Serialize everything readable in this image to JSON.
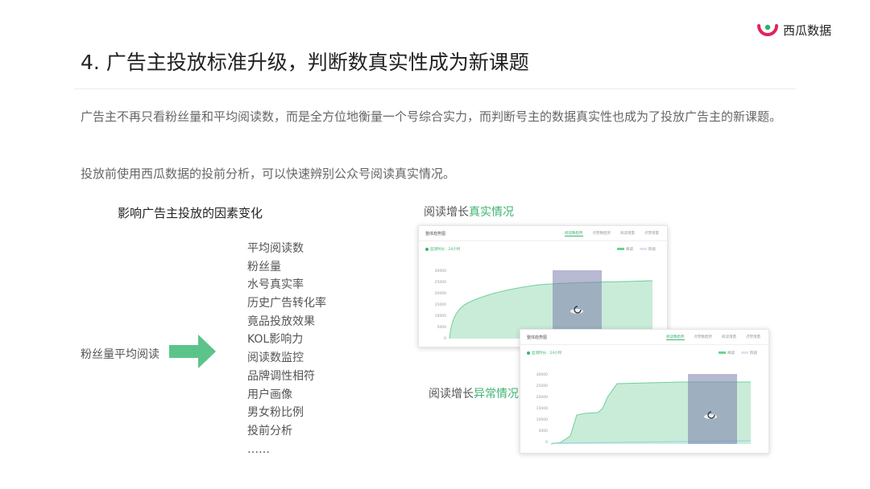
{
  "brand": {
    "name": "西瓜数据",
    "color": "#e0245e"
  },
  "header": {
    "title": "4. 广告主投放标准升级，判断数真实性成为新课题"
  },
  "body": {
    "paragraph1": "广告主不再只看粉丝量和平均阅读数，而是全方位地衡量一个号综合实力，而判断号主的数据真实性也成为了投放广告主的新课题。",
    "paragraph2": "投放前使用西瓜数据的投前分析，可以快速辨别公众号阅读真实情况。"
  },
  "diagram": {
    "heading": "影响广告主投放的因素变化",
    "old_metrics": "粉丝量平均阅读",
    "arrow_color": "#5cc48a",
    "factors": [
      "平均阅读数",
      "粉丝量",
      "水号真实率",
      "历史广告转化率",
      "竟品投放效果",
      "KOL影响力",
      "阅读数监控",
      "品牌调性相符",
      "用户画像",
      "男女粉比例",
      "投前分析",
      "……"
    ]
  },
  "captions": {
    "real": {
      "prefix": "阅读增长",
      "accent": "真实情况"
    },
    "abnormal": {
      "prefix": "阅读增长",
      "accent": "异常情况"
    },
    "accent_color": "#3cb371"
  },
  "cards": [
    {
      "title": "整体趋势图",
      "tabs": [
        "阅读数趋势",
        "点赞数趋势",
        "阅读增量",
        "点赞增量"
      ],
      "active_tab": 0,
      "update_text": "监测时长：24小时",
      "legend": [
        "阅读",
        "阶段"
      ],
      "y_ticks": [
        "30000",
        "25000",
        "20000",
        "15000",
        "10000",
        "5000",
        "0"
      ]
    },
    {
      "title": "整体趋势图",
      "tabs": [
        "阅读数趋势",
        "点赞数趋势",
        "阅读增量",
        "点赞增量"
      ],
      "active_tab": 0,
      "update_text": "监测时长：24小时",
      "legend": [
        "阅读",
        "阶段"
      ],
      "y_ticks": [
        "30000",
        "25000",
        "20000",
        "15000",
        "10000",
        "5000",
        "0"
      ]
    }
  ],
  "colors": {
    "series_fill": "#c9ecd9",
    "series_line": "#6fcf97",
    "highlight": "#7a7fab"
  }
}
